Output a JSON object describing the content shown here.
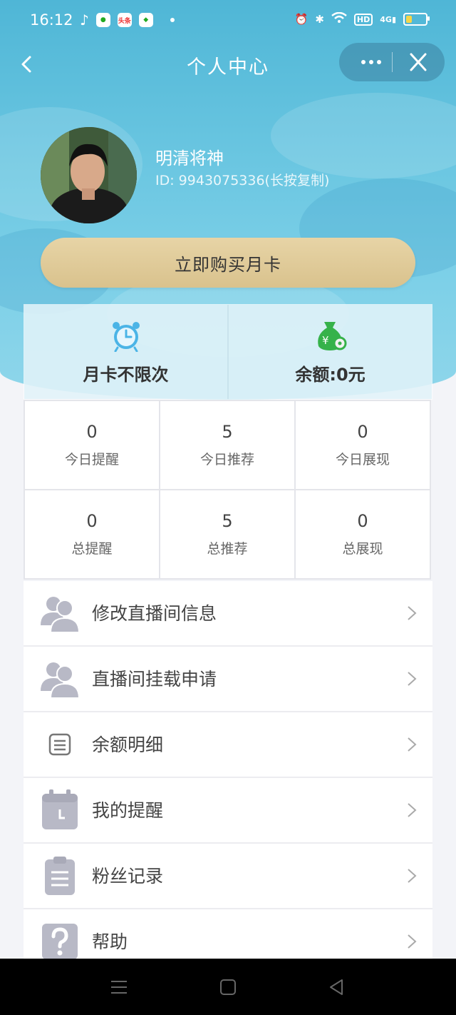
{
  "status_bar": {
    "time": "16:12",
    "badge_toutiao": "头条",
    "hd": "HD",
    "signal": "4G"
  },
  "nav": {
    "title": "个人中心",
    "more_icon": "more-dots-icon",
    "close_icon": "close-icon",
    "back_icon": "back-arrow-icon"
  },
  "profile": {
    "name": "明清将神",
    "id_text": "ID: 9943075336(长按复制)"
  },
  "buy_button": "立即购买月卡",
  "cards": [
    {
      "icon": "alarm-clock-icon",
      "label": "月卡不限次"
    },
    {
      "icon": "money-bag-icon",
      "label": "余额:0元"
    }
  ],
  "stats": [
    {
      "value": "0",
      "label": "今日提醒"
    },
    {
      "value": "5",
      "label": "今日推荐"
    },
    {
      "value": "0",
      "label": "今日展现"
    },
    {
      "value": "0",
      "label": "总提醒"
    },
    {
      "value": "5",
      "label": "总推荐"
    },
    {
      "value": "0",
      "label": "总展现"
    }
  ],
  "menu": [
    {
      "icon": "users-icon",
      "label": "修改直播间信息"
    },
    {
      "icon": "users-icon",
      "label": "直播间挂载申请"
    },
    {
      "icon": "document-icon",
      "label": "余额明细"
    },
    {
      "icon": "calendar-icon",
      "label": "我的提醒"
    },
    {
      "icon": "clipboard-icon",
      "label": "粉丝记录"
    },
    {
      "icon": "help-icon",
      "label": "帮助"
    }
  ],
  "colors": {
    "hero": "#5fbfdc",
    "gold_button": "#ddc793",
    "icon_gray": "#b8b9c6",
    "clock_blue": "#4bb4e6",
    "money_green": "#36b24a"
  }
}
